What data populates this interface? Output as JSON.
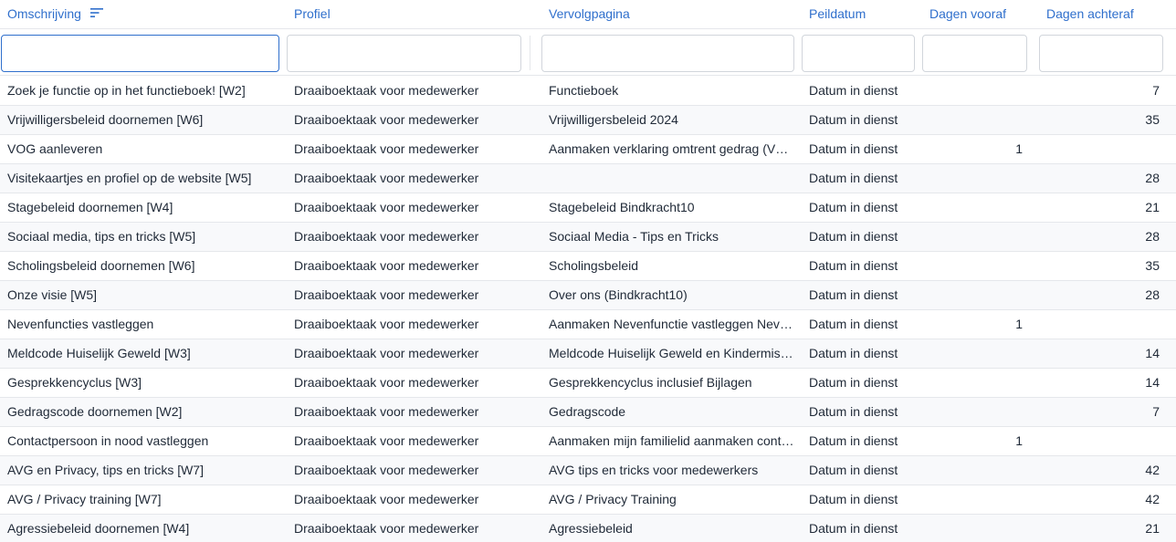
{
  "columns": {
    "omschrijving": "Omschrijving",
    "profiel": "Profiel",
    "vervolgpagina": "Vervolgpagina",
    "peildatum": "Peildatum",
    "dagen_vooraf": "Dagen vooraf",
    "dagen_achteraf": "Dagen achteraf"
  },
  "filters": {
    "omschrijving": "",
    "profiel": "",
    "vervolgpagina": "",
    "peildatum": "",
    "dagen_vooraf": "",
    "dagen_achteraf": ""
  },
  "colors": {
    "accent": "#2f6fcc",
    "border": "#e5e7eb",
    "row_alt": "#f8f9fb"
  },
  "rows": [
    {
      "omschrijving": "Zoek je functie op in het functieboek! [W2]",
      "profiel": "Draaiboektaak voor medewerker",
      "vervolgpagina": "Functieboek",
      "peildatum": "Datum in dienst",
      "dagen_vooraf": "",
      "dagen_achteraf": "7"
    },
    {
      "omschrijving": "Vrijwilligersbeleid doornemen [W6]",
      "profiel": "Draaiboektaak voor medewerker",
      "vervolgpagina": "Vrijwilligersbeleid 2024",
      "peildatum": "Datum in dienst",
      "dagen_vooraf": "",
      "dagen_achteraf": "35"
    },
    {
      "omschrijving": "VOG aanleveren",
      "profiel": "Draaiboektaak voor medewerker",
      "vervolgpagina": "Aanmaken verklaring omtrent gedrag (VOG)",
      "peildatum": "Datum in dienst",
      "dagen_vooraf": "1",
      "dagen_achteraf": ""
    },
    {
      "omschrijving": "Visitekaartjes en profiel op de website [W5]",
      "profiel": "Draaiboektaak voor medewerker",
      "vervolgpagina": "",
      "peildatum": "Datum in dienst",
      "dagen_vooraf": "",
      "dagen_achteraf": "28"
    },
    {
      "omschrijving": "Stagebeleid doornemen [W4]",
      "profiel": "Draaiboektaak voor medewerker",
      "vervolgpagina": "Stagebeleid Bindkracht10",
      "peildatum": "Datum in dienst",
      "dagen_vooraf": "",
      "dagen_achteraf": "21"
    },
    {
      "omschrijving": "Sociaal media, tips en tricks [W5]",
      "profiel": "Draaiboektaak voor medewerker",
      "vervolgpagina": "Sociaal Media - Tips en Tricks",
      "peildatum": "Datum in dienst",
      "dagen_vooraf": "",
      "dagen_achteraf": "28"
    },
    {
      "omschrijving": "Scholingsbeleid doornemen [W6]",
      "profiel": "Draaiboektaak voor medewerker",
      "vervolgpagina": "Scholingsbeleid",
      "peildatum": "Datum in dienst",
      "dagen_vooraf": "",
      "dagen_achteraf": "35"
    },
    {
      "omschrijving": "Onze visie [W5]",
      "profiel": "Draaiboektaak voor medewerker",
      "vervolgpagina": "Over ons (Bindkracht10)",
      "peildatum": "Datum in dienst",
      "dagen_vooraf": "",
      "dagen_achteraf": "28"
    },
    {
      "omschrijving": "Nevenfuncties vastleggen",
      "profiel": "Draaiboektaak voor medewerker",
      "vervolgpagina": "Aanmaken Nevenfunctie vastleggen Nevenfuncties",
      "peildatum": "Datum in dienst",
      "dagen_vooraf": "1",
      "dagen_achteraf": ""
    },
    {
      "omschrijving": "Meldcode Huiselijk Geweld [W3]",
      "profiel": "Draaiboektaak voor medewerker",
      "vervolgpagina": "Meldcode Huiselijk Geweld en Kindermishandeling",
      "peildatum": "Datum in dienst",
      "dagen_vooraf": "",
      "dagen_achteraf": "14"
    },
    {
      "omschrijving": "Gesprekkencyclus [W3]",
      "profiel": "Draaiboektaak voor medewerker",
      "vervolgpagina": "Gesprekkencyclus inclusief Bijlagen",
      "peildatum": "Datum in dienst",
      "dagen_vooraf": "",
      "dagen_achteraf": "14"
    },
    {
      "omschrijving": "Gedragscode doornemen [W2]",
      "profiel": "Draaiboektaak voor medewerker",
      "vervolgpagina": "Gedragscode",
      "peildatum": "Datum in dienst",
      "dagen_vooraf": "",
      "dagen_achteraf": "7"
    },
    {
      "omschrijving": "Contactpersoon in nood vastleggen",
      "profiel": "Draaiboektaak voor medewerker",
      "vervolgpagina": "Aanmaken mijn familielid aanmaken contactpersoon",
      "peildatum": "Datum in dienst",
      "dagen_vooraf": "1",
      "dagen_achteraf": ""
    },
    {
      "omschrijving": "AVG en Privacy, tips en tricks [W7]",
      "profiel": "Draaiboektaak voor medewerker",
      "vervolgpagina": "AVG tips en tricks voor medewerkers",
      "peildatum": "Datum in dienst",
      "dagen_vooraf": "",
      "dagen_achteraf": "42"
    },
    {
      "omschrijving": "AVG / Privacy training [W7]",
      "profiel": "Draaiboektaak voor medewerker",
      "vervolgpagina": "AVG / Privacy Training",
      "peildatum": "Datum in dienst",
      "dagen_vooraf": "",
      "dagen_achteraf": "42"
    },
    {
      "omschrijving": "Agressiebeleid doornemen [W4]",
      "profiel": "Draaiboektaak voor medewerker",
      "vervolgpagina": "Agressiebeleid",
      "peildatum": "Datum in dienst",
      "dagen_vooraf": "",
      "dagen_achteraf": "21"
    }
  ]
}
